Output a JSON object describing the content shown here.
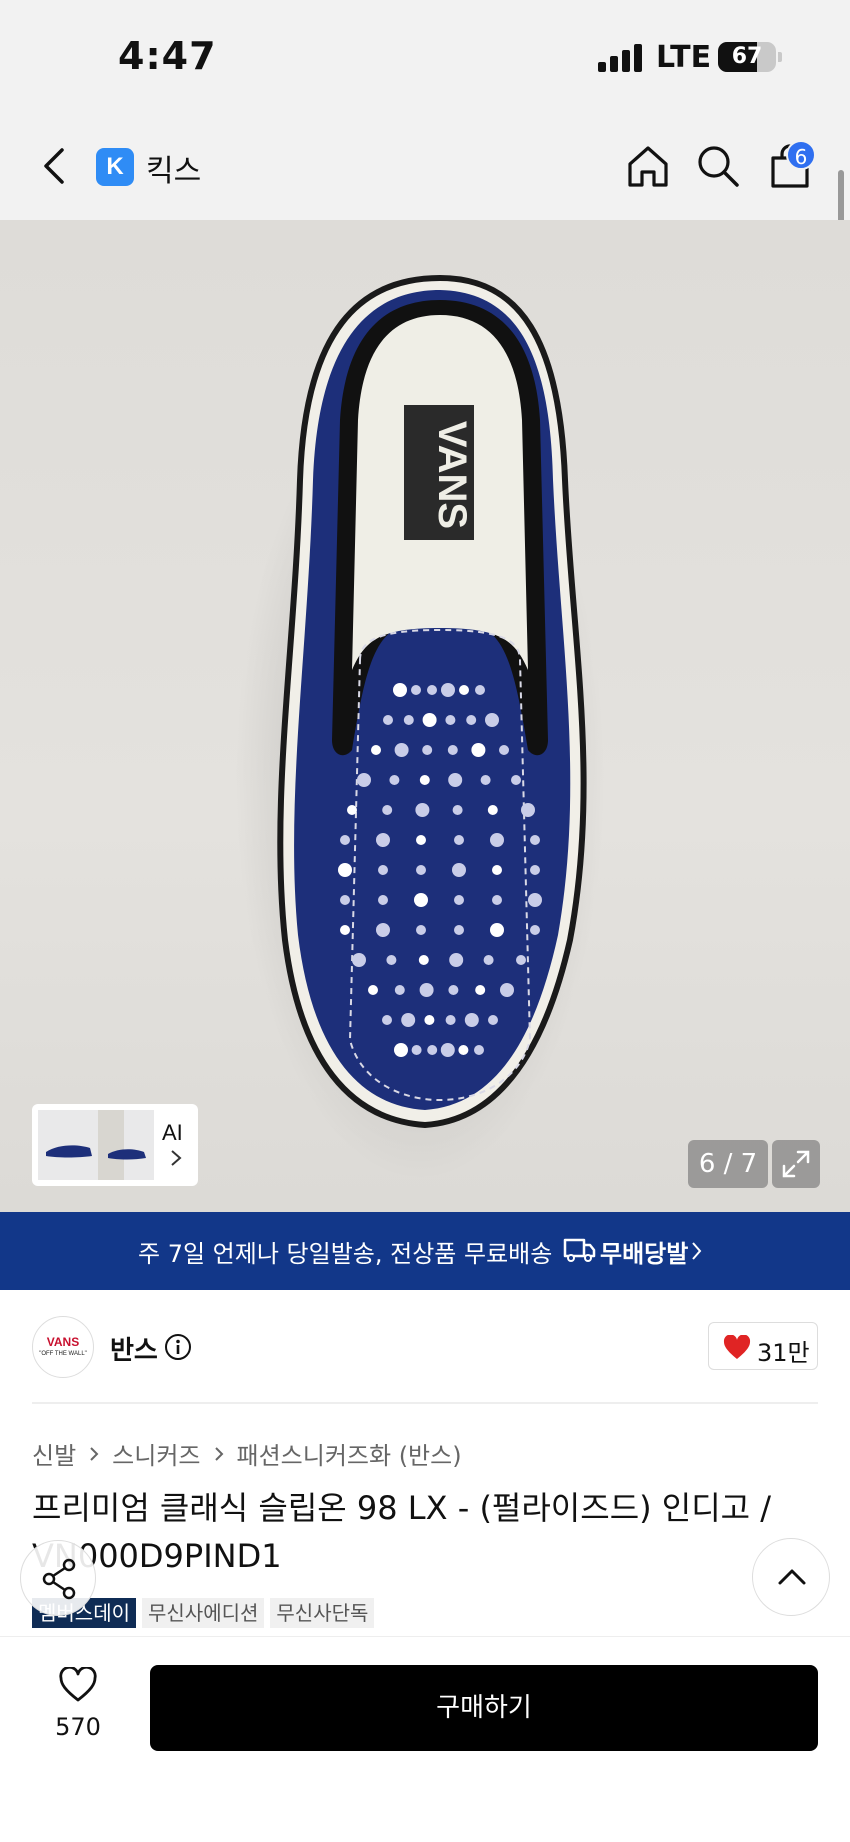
{
  "status_bar": {
    "time": "4:47",
    "network": "LTE",
    "battery": "67",
    "battery_level": 0.67
  },
  "app_bar": {
    "badge_letter": "K",
    "app_name": "킥스",
    "cart_count": "6",
    "icons": [
      "chevron-left-icon",
      "home-icon",
      "search-icon",
      "shopping-bag-icon"
    ]
  },
  "gallery": {
    "ai_label": "AI",
    "counter": "6 / 7"
  },
  "promo": {
    "text": "주 7일 언제나 당일발송, 전상품 무료배송",
    "logo_text": "무배당발"
  },
  "brand": {
    "logo_text": "VANS",
    "logo_sub": "\"OFF THE WALL\"",
    "name": "반스",
    "like_count": "31만"
  },
  "breadcrumb": [
    "신발",
    "스니커즈",
    "패션스니커즈화 (반스)"
  ],
  "product": {
    "title": "프리미엄 클래식 슬립온 98 LX - (펄라이즈드) 인디고 / VN000D9PIND1",
    "tags": [
      "멤버스데이",
      "무신사에디션",
      "무신사단독"
    ]
  },
  "bottom_bar": {
    "wish_count": "570",
    "buy_label": "구매하기"
  },
  "colors": {
    "promo_bg": "#123789",
    "cart_badge": "#2f6ff0",
    "app_badge": "#2f8cf5",
    "shoe_blue": "#1d2f7a",
    "heart": "#e02424"
  }
}
